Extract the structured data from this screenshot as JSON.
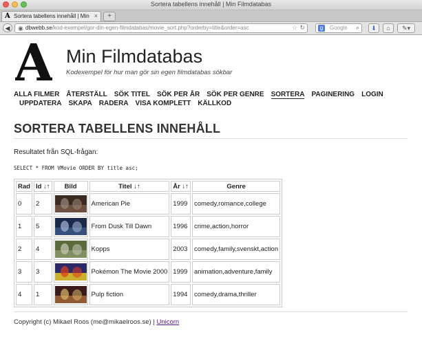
{
  "window": {
    "title": "Sortera tabellens innehåll | Min Filmdatabas"
  },
  "tab": {
    "favicon_letter": "A",
    "title": "Sortera tabellens innehåll | Min ...",
    "close": "×",
    "new_tab": "+"
  },
  "navbar": {
    "url_domain": "dbwebb.se",
    "url_path": "/kod-exempel/gor-din-egen-filmdatabas/movie_sort.php?orderby=title&order=asc",
    "search_engine": "Google",
    "search_engine_letter": "g",
    "icons": [
      "back-icon",
      "globe-icon",
      "star-icon",
      "reload-icon",
      "search-icon",
      "download-icon",
      "home-icon",
      "tools-icon"
    ]
  },
  "site": {
    "logo_letter": "A",
    "title": "Min Filmdatabas",
    "slogan": "Kodexempel för hur man gör sin egen filmdatabas sökbar"
  },
  "menu": {
    "row1": [
      "ALLA FILMER",
      "ÅTERSTÄLL",
      "SÖK TITEL",
      "SÖK PER ÅR",
      "SÖK PER GENRE",
      "SORTERA",
      "PAGINERING",
      "LOGIN"
    ],
    "row2": [
      "UPPDATERA",
      "SKAPA",
      "RADERA",
      "VISA KOMPLETT",
      "KÄLLKOD"
    ],
    "selected": "SORTERA"
  },
  "page": {
    "heading": "SORTERA TABELLENS INNEHÅLL",
    "intro": "Resultatet från SQL-frågan:",
    "sql": "SELECT * FROM VMovie ORDER BY title asc;"
  },
  "table": {
    "headers": {
      "rad": "Rad",
      "id": "Id ↓↑",
      "bild": "Bild",
      "titel": "Titel ↓↑",
      "ar": "År ↓↑",
      "genre": "Genre"
    },
    "rows": [
      {
        "rad": "0",
        "id": "2",
        "title": "American Pie",
        "year": "1999",
        "genre": "comedy,romance,college",
        "thumb_colors": [
          "#3a2a22",
          "#7a5a4a",
          "#9a8a7a"
        ]
      },
      {
        "rad": "1",
        "id": "5",
        "title": "From Dusk Till Dawn",
        "year": "1996",
        "genre": "crime,action,horror",
        "thumb_colors": [
          "#1c2a4a",
          "#3c5a8a",
          "#a8b8d8"
        ]
      },
      {
        "rad": "2",
        "id": "4",
        "title": "Kopps",
        "year": "2003",
        "genre": "comedy,family,svenskt,action",
        "thumb_colors": [
          "#5a6a3a",
          "#8a9a6a",
          "#c8c8b8"
        ]
      },
      {
        "rad": "3",
        "id": "3",
        "title": "Pokémon The Movie 2000",
        "year": "1999",
        "genre": "animation,adventure,family",
        "thumb_colors": [
          "#2a2a6a",
          "#f2d21a",
          "#e23a1a"
        ]
      },
      {
        "rad": "4",
        "id": "1",
        "title": "Pulp fiction",
        "year": "1994",
        "genre": "comedy,drama,thriller",
        "thumb_colors": [
          "#3a1a1a",
          "#a86a3a",
          "#d8b86a"
        ]
      }
    ]
  },
  "footer": {
    "text": "Copyright (c) Mikael Roos (me@mikaelroos.se) | ",
    "link": "Unicorn"
  }
}
